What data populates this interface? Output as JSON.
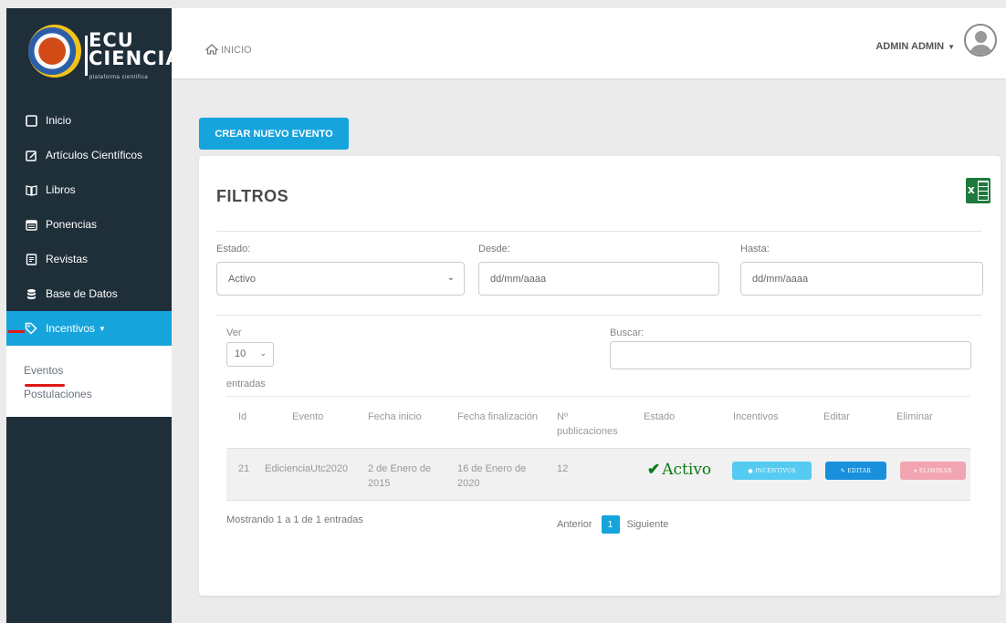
{
  "brand": {
    "line1": "ECU",
    "line2": "CIENCIA",
    "tagline": "plataforma científica"
  },
  "sidebar": {
    "items": [
      {
        "label": "Inicio",
        "icon": "square-icon"
      },
      {
        "label": "Artículos Científicos",
        "icon": "edit-icon"
      },
      {
        "label": "Libros",
        "icon": "book-icon"
      },
      {
        "label": "Ponencias",
        "icon": "calendar-icon"
      },
      {
        "label": "Revistas",
        "icon": "document-icon"
      },
      {
        "label": "Base de Datos",
        "icon": "database-icon"
      },
      {
        "label": "Incentivos",
        "icon": "tag-icon"
      }
    ],
    "submenu": [
      {
        "label": "Eventos"
      },
      {
        "label": "Postulaciones"
      }
    ]
  },
  "header": {
    "breadcrumb": "INICIO",
    "user": "ADMIN ADMIN"
  },
  "create_button": "CREAR NUEVO EVENTO",
  "filters": {
    "title": "FILTROS",
    "estado_label": "Estado:",
    "estado_value": "Activo",
    "desde_label": "Desde:",
    "desde_value": "dd/mm/aaaa",
    "hasta_label": "Hasta:",
    "hasta_value": "dd/mm/aaaa"
  },
  "table_controls": {
    "ver_label": "Ver",
    "ver_value": "10",
    "entradas_label": "entradas",
    "buscar_label": "Buscar:"
  },
  "table": {
    "columns": [
      "Id",
      "Evento",
      "Fecha inicio",
      "Fecha finalización",
      "Nº",
      "publicaciones",
      "Estado",
      "Incentivos",
      "Editar",
      "Eliminar"
    ],
    "rows": [
      {
        "id": "21",
        "evento": "EdicienciaUtc2020",
        "inicio_1": "2 de Enero de",
        "inicio_2": "2015",
        "fin_1": "16 de Enero de",
        "fin_2": "2020",
        "publicaciones": "12",
        "estado": "Activo",
        "incentivos_btn": "INCENTIVOS",
        "editar_btn": "EDITAR",
        "eliminar_btn": "ELIMINAR"
      }
    ]
  },
  "footer": {
    "showing": "Mostrando 1 a 1 de 1 entradas",
    "prev": "Anterior",
    "page": "1",
    "next": "Siguiente"
  },
  "colors": {
    "sidebar": "#1f2f3a",
    "accent": "#16a4dc",
    "active_status": "#0c7a16",
    "delete": "#f2a5b0"
  }
}
